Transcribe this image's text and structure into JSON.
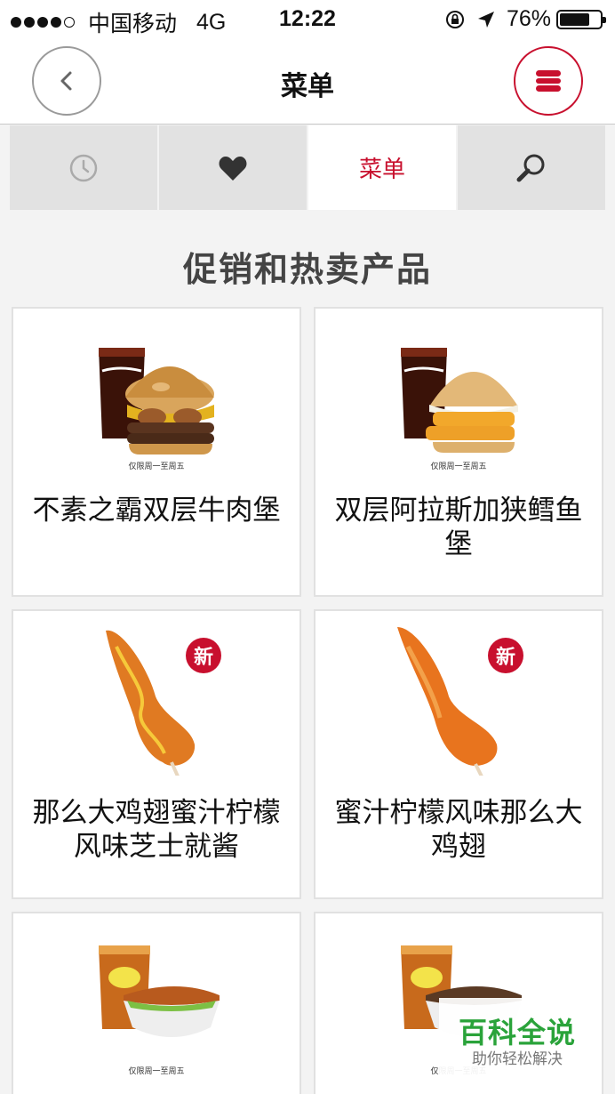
{
  "status_bar": {
    "carrier": "中国移动",
    "network": "4G",
    "time": "12:22",
    "battery": "76%",
    "battery_level": 0.76,
    "signal_dots_filled": 4,
    "signal_dots_total": 5
  },
  "nav": {
    "title": "菜单",
    "back_icon": "chevron-left-icon",
    "menu_icon": "burger-menu-icon",
    "accent_color": "#c8102e"
  },
  "tabs": [
    {
      "icon": "clock-icon",
      "label": ""
    },
    {
      "icon": "heart-icon",
      "label": ""
    },
    {
      "icon": "",
      "label": "菜单",
      "active": true
    },
    {
      "icon": "search-icon",
      "label": ""
    }
  ],
  "section_title": "促销和热卖产品",
  "products": [
    {
      "name": "不素之霸双层牛肉堡",
      "image": "double-beef-burger-with-cola",
      "caption": "仅限周一至周五",
      "badge": ""
    },
    {
      "name": "双层阿拉斯加狭鳕鱼堡",
      "image": "double-fish-burger-with-cola",
      "caption": "仅限周一至周五",
      "badge": ""
    },
    {
      "name": "那么大鸡翅蜜汁柠檬风味芝士就酱",
      "image": "chicken-wing-with-cheese-sauce",
      "caption": "",
      "badge": "新"
    },
    {
      "name": "蜜汁柠檬风味那么大鸡翅",
      "image": "honey-lemon-chicken-wing",
      "caption": "",
      "badge": "新"
    },
    {
      "name": "",
      "image": "chicken-rice-bowl-with-fuze-tea",
      "caption": "仅限周一至周五",
      "badge": ""
    },
    {
      "name": "",
      "image": "beef-rice-bowl-with-fuze-tea",
      "caption": "仅限周一至周五",
      "badge": ""
    }
  ],
  "watermark": {
    "title": "百科全说",
    "subtitle": "助你轻松解决"
  }
}
